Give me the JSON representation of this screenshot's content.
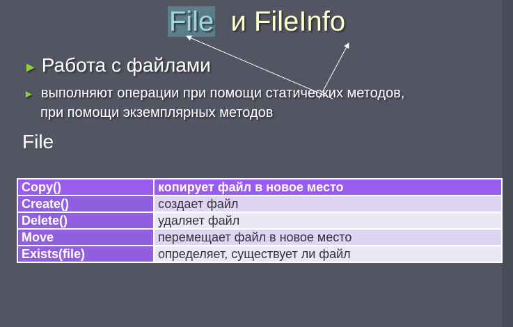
{
  "title": {
    "part1": "File",
    "part2": "и FileInfo"
  },
  "bullets": {
    "main": "Работа с файлами",
    "sub_line1": "выполняют операции при помощи статических методов,",
    "sub_line2": "при помощи экземплярных методов"
  },
  "section_heading": "File",
  "methods_table": {
    "rows": [
      {
        "method": "Copy()",
        "description": "копирует файл в новое место"
      },
      {
        "method": "Create()",
        "description": "создает файл"
      },
      {
        "method": "Delete()",
        "description": "удаляет файл"
      },
      {
        "method": "Move",
        "description": "перемещает файл в новое место"
      },
      {
        "method": "Exists(file)",
        "description": "определяет, существует ли файл"
      }
    ]
  },
  "colors": {
    "background": "#545563",
    "table_header": "#9a5cf0",
    "method_cell": "#8f5fdf",
    "description_cell": "#ddd5f2",
    "bullet_arrow": "#8ccf3a"
  }
}
